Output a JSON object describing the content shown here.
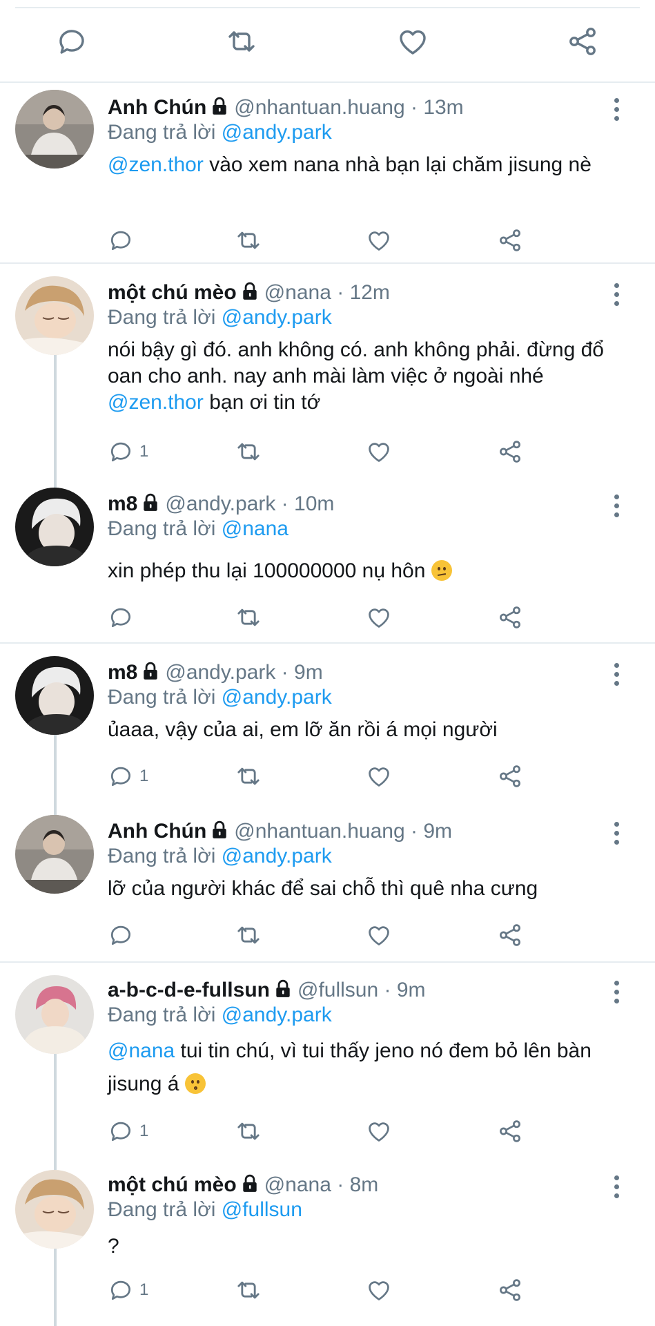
{
  "colors": {
    "link": "#1d9bf0",
    "muted": "#657786",
    "border": "#e6ecf0"
  },
  "icons": {
    "reply": "reply-icon",
    "retweet": "retweet-icon",
    "like": "heart-icon",
    "share": "share-icon",
    "more": "more-vertical-icon",
    "lock": "lock-icon"
  },
  "replying_label": "Đang trả lời",
  "tweets": [
    {
      "name": "Anh Chún",
      "handle": "@nhantuan.huang",
      "time": "13m",
      "replying_to": "@andy.park",
      "mention": "@zen.thor",
      "text": " vào xem nana nhà bạn lại chăm jisung nè",
      "reply_count": ""
    },
    {
      "name": "một chú mèo",
      "handle": "@nana",
      "time": "12m",
      "replying_to": "@andy.park",
      "text": "nói bậy gì đó. anh không có. anh không phải. đừng đổ oan cho anh. nay anh mài làm việc ở ngoài nhé ",
      "mention": "@zen.thor",
      "text_after": " bạn ơi tin tớ",
      "reply_count": "1"
    },
    {
      "name": "m8",
      "handle": "@andy.park",
      "time": "10m",
      "replying_to": "@nana",
      "text": "xin phép thu lại 100000000 nụ hôn ",
      "emoji": "confused-face-emoji",
      "reply_count": ""
    },
    {
      "name": "m8",
      "handle": "@andy.park",
      "time": "9m",
      "replying_to": "@andy.park",
      "text": "ủaaa, vậy của ai, em lỡ ăn rồi á mọi người",
      "reply_count": "1"
    },
    {
      "name": "Anh Chún",
      "handle": "@nhantuan.huang",
      "time": "9m",
      "replying_to": "@andy.park",
      "text": "lỡ của người khác để sai chỗ thì quê nha cưng",
      "reply_count": ""
    },
    {
      "name": "a-b-c-d-e-fullsun",
      "handle": "@fullsun",
      "time": "9m",
      "replying_to": "@andy.park",
      "mention": "@nana",
      "text": " tui tin chú, vì tui thấy jeno nó đem bỏ lên bàn jisung á ",
      "emoji": "kissing-face-emoji",
      "reply_count": "1"
    },
    {
      "name": "một chú mèo",
      "handle": "@nana",
      "time": "8m",
      "replying_to": "@fullsun",
      "text": "?",
      "reply_count": "1"
    }
  ]
}
